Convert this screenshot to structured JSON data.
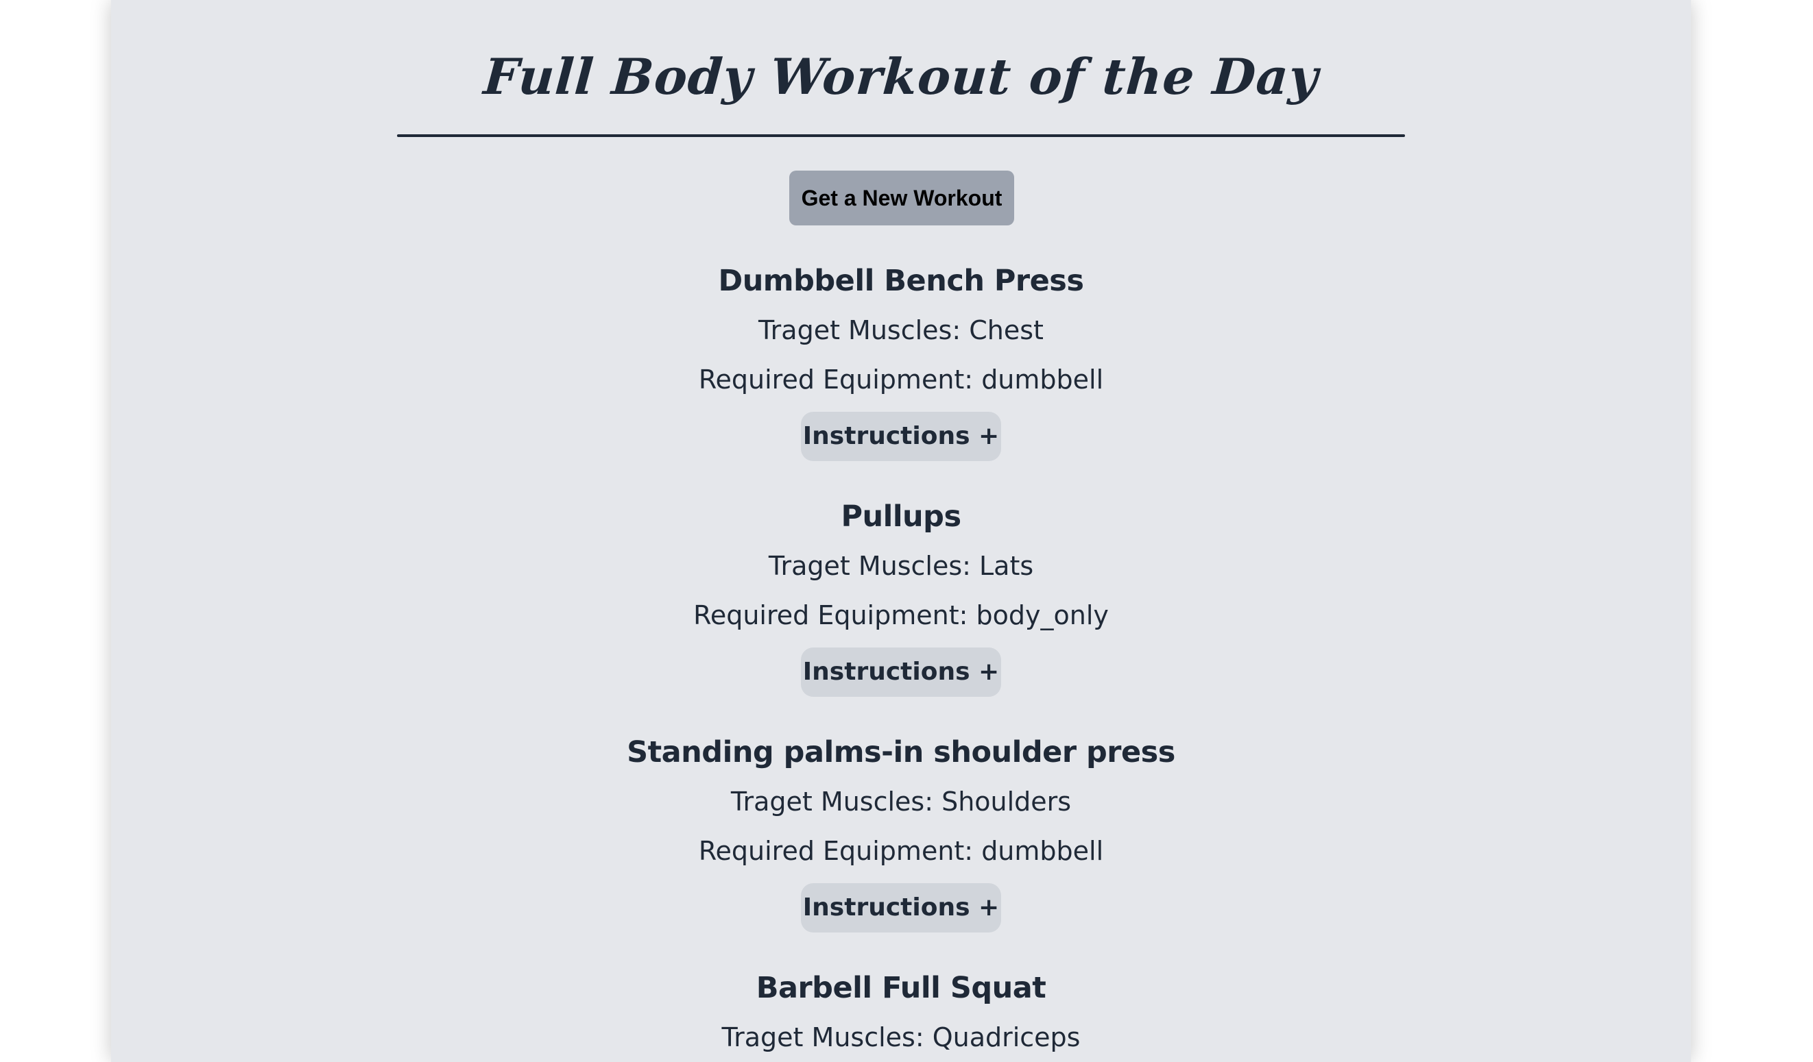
{
  "header": {
    "title": "Full Body Workout of the Day"
  },
  "controls": {
    "new_workout_label": "Get a New Workout"
  },
  "labels": {
    "target_prefix": "Traget Muscles: ",
    "equipment_prefix": "Required Equipment: ",
    "instructions_label": "Instructions +"
  },
  "exercises": [
    {
      "name": "Dumbbell Bench Press",
      "target_line": "Traget Muscles: Chest",
      "equipment_line": "Required Equipment: dumbbell",
      "instructions_label": "Instructions +"
    },
    {
      "name": "Pullups",
      "target_line": "Traget Muscles: Lats",
      "equipment_line": "Required Equipment: body_only",
      "instructions_label": "Instructions +"
    },
    {
      "name": "Standing palms-in shoulder press",
      "target_line": "Traget Muscles: Shoulders",
      "equipment_line": "Required Equipment: dumbbell",
      "instructions_label": "Instructions +"
    },
    {
      "name": "Barbell Full Squat",
      "target_line": "Traget Muscles: Quadriceps",
      "equipment_line": "",
      "instructions_label": ""
    }
  ],
  "colors": {
    "panel_background": "#e5e7eb",
    "text": "#1f2937",
    "primary_button": "#9ca3af",
    "instructions_button": "#d1d5db"
  }
}
